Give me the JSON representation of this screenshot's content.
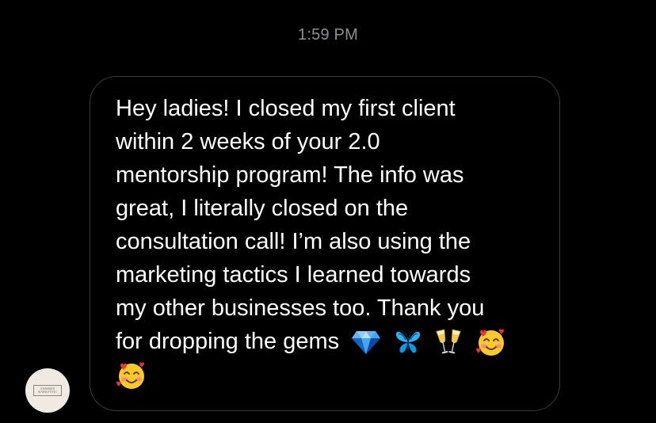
{
  "conversation": {
    "timestamp": "1:59 PM"
  },
  "message": {
    "lines": [
      "Hey ladies! I closed my first client",
      "within 2 weeks of your 2.0",
      "mentorship program! The info was",
      "great, I literally closed on the",
      "consultation call! I’m also using the",
      "marketing tactics I learned towards",
      "my other businesses too. Thank you",
      "for dropping the gems"
    ],
    "trailing_emojis": [
      "gem-stone-emoji",
      "butterfly-emoji",
      "clinking-glasses-emoji",
      "smiling-face-with-hearts-emoji"
    ],
    "last_line_emoji": "smiling-face-with-hearts-emoji"
  },
  "avatar": {
    "logo_line1": "ADMIRED",
    "logo_line2": "MARKETING"
  },
  "colors": {
    "background": "#000000",
    "bubble_border": "#3c3c3e",
    "text": "#ffffff",
    "timestamp": "#8e8e93",
    "avatar_bg": "#efebe2"
  }
}
